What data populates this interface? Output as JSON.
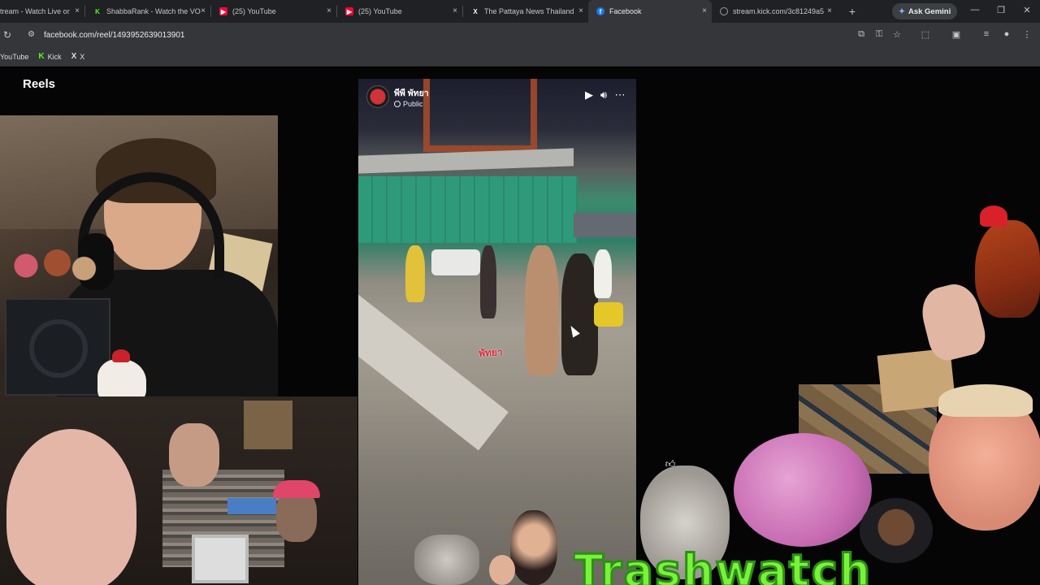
{
  "browser": {
    "tabs": [
      {
        "title": "tream - Watch Live or",
        "favicon": "kick-icon",
        "color": "#53fc18",
        "active": false
      },
      {
        "title": "ShabbaRank - Watch the VO",
        "favicon": "kick-icon",
        "color": "#53fc18",
        "active": false
      },
      {
        "title": "(25) YouTube",
        "favicon": "youtube-icon",
        "color": "#ff0033",
        "active": false
      },
      {
        "title": "(25) YouTube",
        "favicon": "youtube-icon",
        "color": "#ff0033",
        "active": false
      },
      {
        "title": "The Pattaya News Thailand",
        "favicon": "x-icon",
        "color": "#ffffff",
        "active": false
      },
      {
        "title": "Facebook",
        "favicon": "facebook-icon",
        "color": "#1877f2",
        "active": true
      },
      {
        "title": "stream.kick.com/3c81249a5",
        "favicon": "globe-icon",
        "color": "#9aa0a6",
        "active": false
      }
    ],
    "close_glyph": "×",
    "new_tab_glyph": "+",
    "gemini_label": "Ask Gemini",
    "url": "facebook.com/reel/1493952639013901",
    "bookmarks": [
      {
        "label": "YouTube",
        "icon": ""
      },
      {
        "label": "Kick",
        "icon": "K"
      },
      {
        "label": "X",
        "icon": "X"
      }
    ]
  },
  "page": {
    "section_title": "Reels",
    "reel": {
      "poster_name": "พีพี พัทยา",
      "visibility": "Public",
      "watermark": "พัทยา"
    }
  },
  "overlay": {
    "logo_text": "Trashwatch"
  },
  "colors": {
    "tab_bar": "#202124",
    "toolbar": "#35363a",
    "page_bg": "#050505",
    "logo_green": "#7af23a"
  }
}
